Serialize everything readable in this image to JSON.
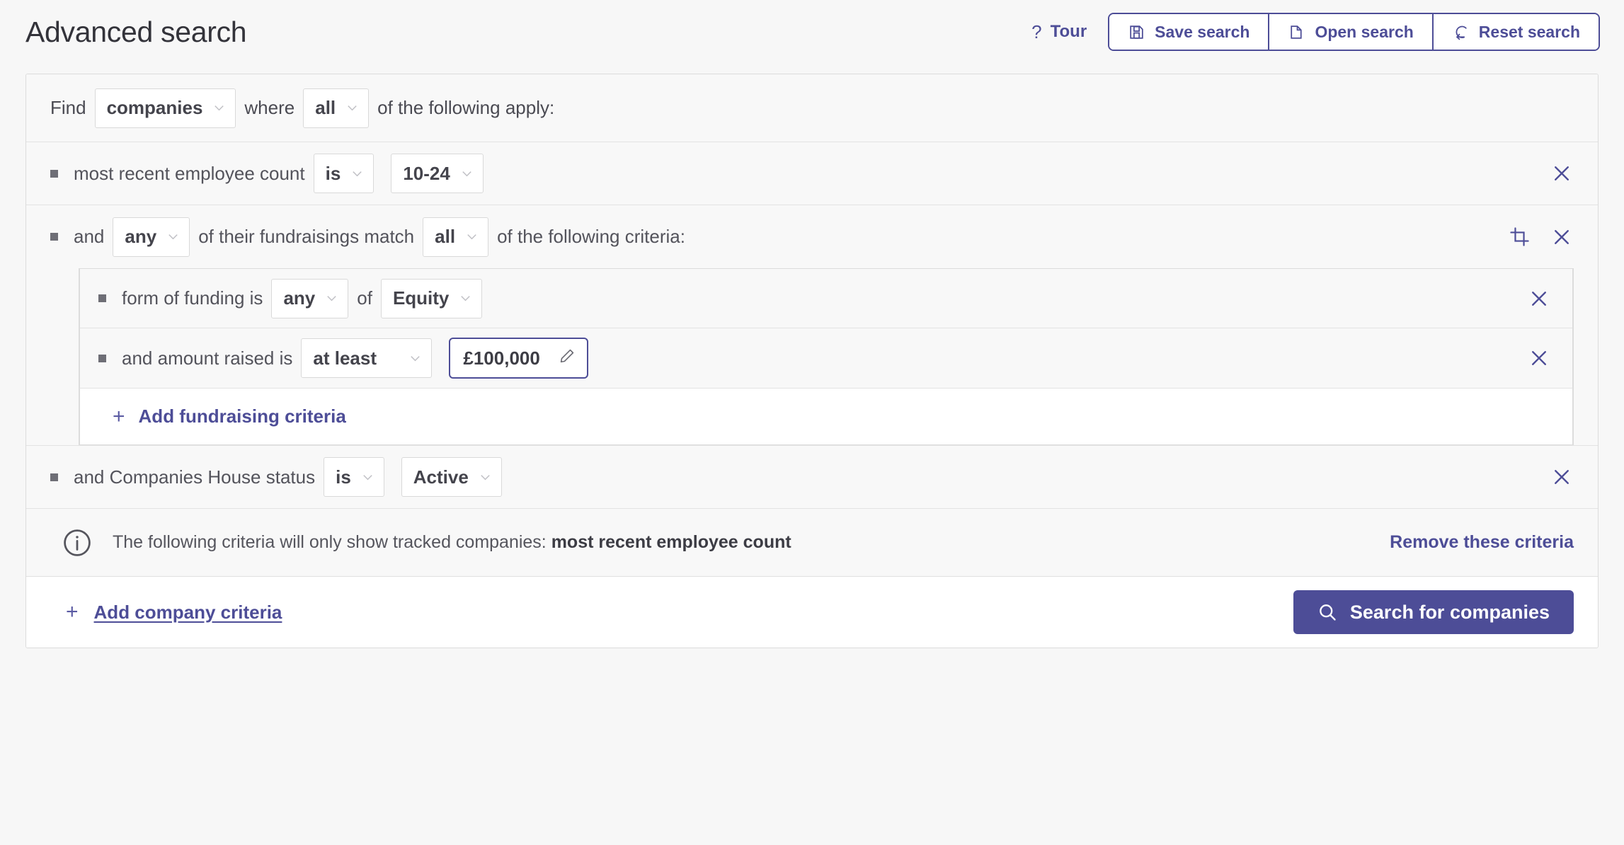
{
  "header": {
    "title": "Advanced search",
    "tour_label": "Tour",
    "tour_icon": "question-mark-icon",
    "buttons": [
      {
        "label": "Save search",
        "icon": "save-disk-icon"
      },
      {
        "label": "Open search",
        "icon": "folder-open-icon"
      },
      {
        "label": "Reset search",
        "icon": "reset-arrow-icon"
      }
    ]
  },
  "find": {
    "prefix": "Find",
    "entity_value": "companies",
    "middle": "where",
    "match_value": "all",
    "suffix": "of the following apply:"
  },
  "criteria": [
    {
      "label": "most recent employee count",
      "operator": "is",
      "value": "10-24"
    }
  ],
  "nested_group": {
    "prefix": "and",
    "quantifier": "any",
    "middle": "of their fundraisings match",
    "match_value": "all",
    "suffix": "of the following criteria:",
    "icons": {
      "crop": "crop-icon",
      "close": "close-icon"
    },
    "sub_criteria": [
      {
        "label": "form of funding is",
        "operator": "any",
        "connector": "of",
        "value": "Equity",
        "value_type": "select"
      },
      {
        "label": "and amount raised is",
        "operator": "at least",
        "connector": "",
        "value": "£100,000",
        "value_type": "input",
        "edit_icon": "pencil-icon"
      }
    ],
    "add_label": "Add fundraising criteria"
  },
  "status_criteria": {
    "label": "and Companies House status",
    "operator": "is",
    "value": "Active"
  },
  "info": {
    "icon": "info-circle-icon",
    "text_prefix": "The following criteria will only show tracked companies: ",
    "text_bold": "most recent employee count",
    "remove_label": "Remove these criteria"
  },
  "footer": {
    "add_label": "Add company criteria",
    "search_label": "Search for companies",
    "search_icon": "magnifier-icon"
  },
  "colors": {
    "accent": "#4d4d97",
    "page_bg": "#f7f7f7",
    "row_bg": "#f8f8f8",
    "text": "#53535b"
  }
}
